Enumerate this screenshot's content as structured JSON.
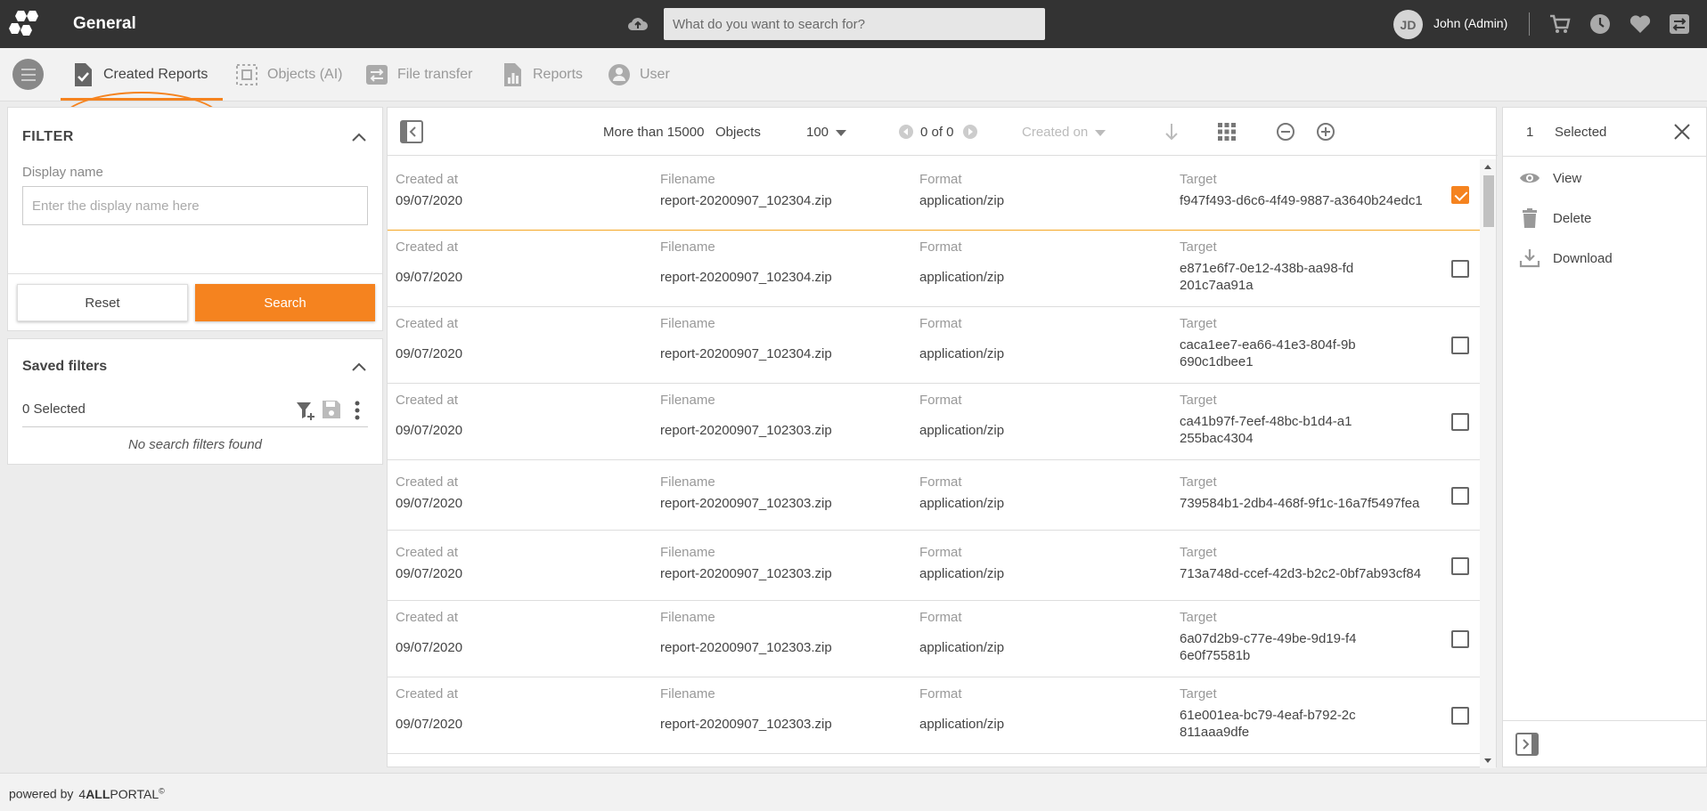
{
  "app": {
    "title": "General"
  },
  "search": {
    "placeholder": "What do you want to search for?"
  },
  "user": {
    "initials": "JD",
    "name": "John (Admin)"
  },
  "tabs": [
    {
      "label": "Created Reports",
      "active": true
    },
    {
      "label": "Objects (AI)"
    },
    {
      "label": "File transfer"
    },
    {
      "label": "Reports"
    },
    {
      "label": "User"
    }
  ],
  "filter": {
    "title": "FILTER",
    "display_name_label": "Display name",
    "display_name_placeholder": "Enter the display name here",
    "reset_label": "Reset",
    "search_label": "Search"
  },
  "saved_filters": {
    "title": "Saved filters",
    "selected": "0 Selected",
    "empty": "No search filters found"
  },
  "toolbar": {
    "count": "More than 15000",
    "objects": "Objects",
    "page_size": "100",
    "pagination": "0 of 0",
    "sort": "Created on"
  },
  "columns": {
    "created": "Created at",
    "filename": "Filename",
    "format": "Format",
    "target": "Target"
  },
  "rows": [
    {
      "created": "09/07/2020",
      "filename": "report-20200907_102304.zip",
      "format": "application/zip",
      "target": "f947f493-d6c6-4f49-9887-a3640b24edc1",
      "checked": true
    },
    {
      "created": "09/07/2020",
      "filename": "report-20200907_102304.zip",
      "format": "application/zip",
      "target": "e871e6f7-0e12-438b-aa98-fd201c7aa91a",
      "checked": false
    },
    {
      "created": "09/07/2020",
      "filename": "report-20200907_102304.zip",
      "format": "application/zip",
      "target": "caca1ee7-ea66-41e3-804f-9b690c1dbee1",
      "checked": false
    },
    {
      "created": "09/07/2020",
      "filename": "report-20200907_102303.zip",
      "format": "application/zip",
      "target": "ca41b97f-7eef-48bc-b1d4-a1255bac4304",
      "checked": false
    },
    {
      "created": "09/07/2020",
      "filename": "report-20200907_102303.zip",
      "format": "application/zip",
      "target": "739584b1-2db4-468f-9f1c-16a7f5497fea",
      "checked": false
    },
    {
      "created": "09/07/2020",
      "filename": "report-20200907_102303.zip",
      "format": "application/zip",
      "target": "713a748d-ccef-42d3-b2c2-0bf7ab93cf84",
      "checked": false
    },
    {
      "created": "09/07/2020",
      "filename": "report-20200907_102303.zip",
      "format": "application/zip",
      "target": "6a07d2b9-c77e-49be-9d19-f46e0f75581b",
      "checked": false
    },
    {
      "created": "09/07/2020",
      "filename": "report-20200907_102303.zip",
      "format": "application/zip",
      "target": "61e001ea-bc79-4eaf-b792-2c811aaa9dfe",
      "checked": false
    }
  ],
  "selection": {
    "count": "1",
    "label": "Selected",
    "actions": [
      "View",
      "Delete",
      "Download"
    ]
  },
  "footer": {
    "powered": "powered by",
    "brand_prefix": "4",
    "brand_bold": "ALL",
    "brand_suffix": "PORTAL",
    "brand_mark": "©"
  },
  "colors": {
    "accent": "#f5831f",
    "topbar": "#333333"
  }
}
